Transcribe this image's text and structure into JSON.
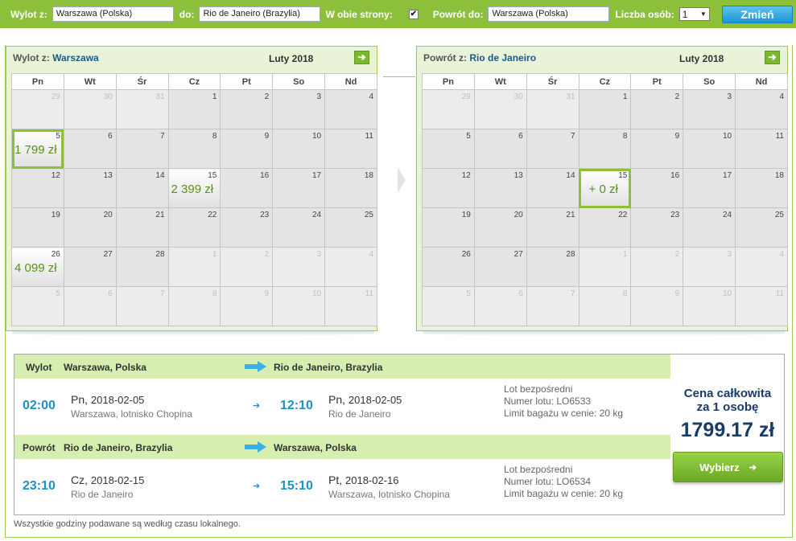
{
  "search": {
    "from_label": "Wylot z:",
    "from_value": "Warszawa (Polska)",
    "to_label": "do:",
    "to_value": "Rio de Janeiro (Brazylia)",
    "round_trip_label": "W obie strony:",
    "round_trip_checked": "✔",
    "return_label": "Powrót do:",
    "return_value": "Warszawa (Polska)",
    "persons_label": "Liczba osób:",
    "persons_value": "1",
    "change_button": "Zmień"
  },
  "weekdays": [
    "Pn",
    "Wt",
    "Śr",
    "Cz",
    "Pt",
    "So",
    "Nd"
  ],
  "outbound_calendar": {
    "title_prefix": "Wylot z:",
    "title_city": "Warszawa",
    "month": "Luty 2018",
    "next_icon": "arrow-right-icon",
    "weeks": [
      [
        {
          "d": "29",
          "o": true
        },
        {
          "d": "30",
          "o": true
        },
        {
          "d": "31",
          "o": true
        },
        {
          "d": "1"
        },
        {
          "d": "2"
        },
        {
          "d": "3"
        },
        {
          "d": "4"
        }
      ],
      [
        {
          "d": "5",
          "p": "1 799 zł",
          "sel": true
        },
        {
          "d": "6"
        },
        {
          "d": "7"
        },
        {
          "d": "8"
        },
        {
          "d": "9"
        },
        {
          "d": "10"
        },
        {
          "d": "11"
        }
      ],
      [
        {
          "d": "12"
        },
        {
          "d": "13"
        },
        {
          "d": "14"
        },
        {
          "d": "15",
          "p": "2 399 zł"
        },
        {
          "d": "16"
        },
        {
          "d": "17"
        },
        {
          "d": "18"
        }
      ],
      [
        {
          "d": "19"
        },
        {
          "d": "20"
        },
        {
          "d": "21"
        },
        {
          "d": "22"
        },
        {
          "d": "23"
        },
        {
          "d": "24"
        },
        {
          "d": "25"
        }
      ],
      [
        {
          "d": "26",
          "p": "4 099 zł"
        },
        {
          "d": "27"
        },
        {
          "d": "28"
        },
        {
          "d": "1",
          "o": true
        },
        {
          "d": "2",
          "o": true
        },
        {
          "d": "3",
          "o": true
        },
        {
          "d": "4",
          "o": true
        }
      ],
      [
        {
          "d": "5",
          "o": true
        },
        {
          "d": "6",
          "o": true
        },
        {
          "d": "7",
          "o": true
        },
        {
          "d": "8",
          "o": true
        },
        {
          "d": "9",
          "o": true
        },
        {
          "d": "10",
          "o": true
        },
        {
          "d": "11",
          "o": true
        }
      ]
    ]
  },
  "return_calendar": {
    "title_prefix": "Powrót z:",
    "title_city": "Rio de Janeiro",
    "month": "Luty 2018",
    "next_icon": "arrow-right-icon",
    "weeks": [
      [
        {
          "d": "29",
          "o": true
        },
        {
          "d": "30",
          "o": true
        },
        {
          "d": "31",
          "o": true
        },
        {
          "d": "1"
        },
        {
          "d": "2"
        },
        {
          "d": "3"
        },
        {
          "d": "4"
        }
      ],
      [
        {
          "d": "5"
        },
        {
          "d": "6"
        },
        {
          "d": "7"
        },
        {
          "d": "8"
        },
        {
          "d": "9"
        },
        {
          "d": "10"
        },
        {
          "d": "11"
        }
      ],
      [
        {
          "d": "12"
        },
        {
          "d": "13"
        },
        {
          "d": "14"
        },
        {
          "d": "15",
          "p": "+ 0 zł",
          "sel": true
        },
        {
          "d": "16"
        },
        {
          "d": "17"
        },
        {
          "d": "18"
        }
      ],
      [
        {
          "d": "19"
        },
        {
          "d": "20"
        },
        {
          "d": "21"
        },
        {
          "d": "22"
        },
        {
          "d": "23"
        },
        {
          "d": "24"
        },
        {
          "d": "25"
        }
      ],
      [
        {
          "d": "26"
        },
        {
          "d": "27"
        },
        {
          "d": "28"
        },
        {
          "d": "1",
          "o": true
        },
        {
          "d": "2",
          "o": true
        },
        {
          "d": "3",
          "o": true
        },
        {
          "d": "4",
          "o": true
        }
      ],
      [
        {
          "d": "5",
          "o": true
        },
        {
          "d": "6",
          "o": true
        },
        {
          "d": "7",
          "o": true
        },
        {
          "d": "8",
          "o": true
        },
        {
          "d": "9",
          "o": true
        },
        {
          "d": "10",
          "o": true
        },
        {
          "d": "11",
          "o": true
        }
      ]
    ]
  },
  "outbound": {
    "label": "Wylot",
    "from": "Warszawa, Polska",
    "to": "Rio de Janeiro, Brazylia",
    "dep_time": "02:00",
    "dep_day": "Pn,",
    "dep_date": "2018-02-05",
    "dep_place": "Warszawa, lotnisko Chopina",
    "arr_time": "12:10",
    "arr_day": "Pn,",
    "arr_date": "2018-02-05",
    "arr_place": "Rio de Janeiro",
    "direct": "Lot bezpośredni",
    "flight_no": "Numer lotu: LO6533",
    "baggage": "Limit bagażu w cenie: 20 kg"
  },
  "return": {
    "label": "Powrót",
    "from": "Rio de Janeiro, Brazylia",
    "to": "Warszawa, Polska",
    "dep_time": "23:10",
    "dep_day": "Cz,",
    "dep_date": "2018-02-15",
    "dep_place": "Rio de Janeiro",
    "arr_time": "15:10",
    "arr_day": "Pt,",
    "arr_date": "2018-02-16",
    "arr_place": "Warszawa, lotnisko Chopina",
    "direct": "Lot bezpośredni",
    "flight_no": "Numer lotu: LO6534",
    "baggage": "Limit bagażu w cenie: 20 kg"
  },
  "price": {
    "label_line1": "Cena całkowita",
    "label_line2": "za 1 osobę",
    "amount": "1799.17 zł",
    "choose_button": "Wybierz",
    "choose_arrow": "➔"
  },
  "note": "Wszystkie godziny podawane są według czasu lokalnego.",
  "colors": {
    "accent_green": "#8cbf3a",
    "accent_blue": "#1f8fc4",
    "price_green": "#5d8f1c"
  }
}
